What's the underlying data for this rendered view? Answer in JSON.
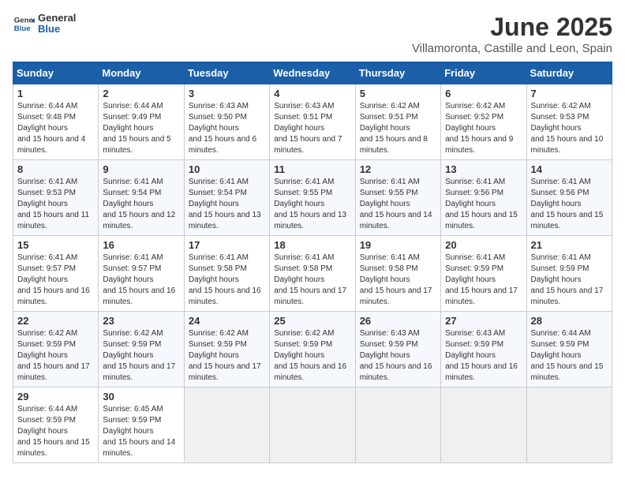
{
  "header": {
    "logo_line1": "General",
    "logo_line2": "Blue",
    "title": "June 2025",
    "subtitle": "Villamoronta, Castille and Leon, Spain"
  },
  "weekdays": [
    "Sunday",
    "Monday",
    "Tuesday",
    "Wednesday",
    "Thursday",
    "Friday",
    "Saturday"
  ],
  "weeks": [
    [
      {
        "day": "1",
        "rise": "6:44 AM",
        "set": "9:48 PM",
        "hours": "15 hours and 4 minutes."
      },
      {
        "day": "2",
        "rise": "6:44 AM",
        "set": "9:49 PM",
        "hours": "15 hours and 5 minutes."
      },
      {
        "day": "3",
        "rise": "6:43 AM",
        "set": "9:50 PM",
        "hours": "15 hours and 6 minutes."
      },
      {
        "day": "4",
        "rise": "6:43 AM",
        "set": "9:51 PM",
        "hours": "15 hours and 7 minutes."
      },
      {
        "day": "5",
        "rise": "6:42 AM",
        "set": "9:51 PM",
        "hours": "15 hours and 8 minutes."
      },
      {
        "day": "6",
        "rise": "6:42 AM",
        "set": "9:52 PM",
        "hours": "15 hours and 9 minutes."
      },
      {
        "day": "7",
        "rise": "6:42 AM",
        "set": "9:53 PM",
        "hours": "15 hours and 10 minutes."
      }
    ],
    [
      {
        "day": "8",
        "rise": "6:41 AM",
        "set": "9:53 PM",
        "hours": "15 hours and 11 minutes."
      },
      {
        "day": "9",
        "rise": "6:41 AM",
        "set": "9:54 PM",
        "hours": "15 hours and 12 minutes."
      },
      {
        "day": "10",
        "rise": "6:41 AM",
        "set": "9:54 PM",
        "hours": "15 hours and 13 minutes."
      },
      {
        "day": "11",
        "rise": "6:41 AM",
        "set": "9:55 PM",
        "hours": "15 hours and 13 minutes."
      },
      {
        "day": "12",
        "rise": "6:41 AM",
        "set": "9:55 PM",
        "hours": "15 hours and 14 minutes."
      },
      {
        "day": "13",
        "rise": "6:41 AM",
        "set": "9:56 PM",
        "hours": "15 hours and 15 minutes."
      },
      {
        "day": "14",
        "rise": "6:41 AM",
        "set": "9:56 PM",
        "hours": "15 hours and 15 minutes."
      }
    ],
    [
      {
        "day": "15",
        "rise": "6:41 AM",
        "set": "9:57 PM",
        "hours": "15 hours and 16 minutes."
      },
      {
        "day": "16",
        "rise": "6:41 AM",
        "set": "9:57 PM",
        "hours": "15 hours and 16 minutes."
      },
      {
        "day": "17",
        "rise": "6:41 AM",
        "set": "9:58 PM",
        "hours": "15 hours and 16 minutes."
      },
      {
        "day": "18",
        "rise": "6:41 AM",
        "set": "9:58 PM",
        "hours": "15 hours and 17 minutes."
      },
      {
        "day": "19",
        "rise": "6:41 AM",
        "set": "9:58 PM",
        "hours": "15 hours and 17 minutes."
      },
      {
        "day": "20",
        "rise": "6:41 AM",
        "set": "9:59 PM",
        "hours": "15 hours and 17 minutes."
      },
      {
        "day": "21",
        "rise": "6:41 AM",
        "set": "9:59 PM",
        "hours": "15 hours and 17 minutes."
      }
    ],
    [
      {
        "day": "22",
        "rise": "6:42 AM",
        "set": "9:59 PM",
        "hours": "15 hours and 17 minutes."
      },
      {
        "day": "23",
        "rise": "6:42 AM",
        "set": "9:59 PM",
        "hours": "15 hours and 17 minutes."
      },
      {
        "day": "24",
        "rise": "6:42 AM",
        "set": "9:59 PM",
        "hours": "15 hours and 17 minutes."
      },
      {
        "day": "25",
        "rise": "6:42 AM",
        "set": "9:59 PM",
        "hours": "15 hours and 16 minutes."
      },
      {
        "day": "26",
        "rise": "6:43 AM",
        "set": "9:59 PM",
        "hours": "15 hours and 16 minutes."
      },
      {
        "day": "27",
        "rise": "6:43 AM",
        "set": "9:59 PM",
        "hours": "15 hours and 16 minutes."
      },
      {
        "day": "28",
        "rise": "6:44 AM",
        "set": "9:59 PM",
        "hours": "15 hours and 15 minutes."
      }
    ],
    [
      {
        "day": "29",
        "rise": "6:44 AM",
        "set": "9:59 PM",
        "hours": "15 hours and 15 minutes."
      },
      {
        "day": "30",
        "rise": "6:45 AM",
        "set": "9:59 PM",
        "hours": "15 hours and 14 minutes."
      },
      null,
      null,
      null,
      null,
      null
    ]
  ]
}
